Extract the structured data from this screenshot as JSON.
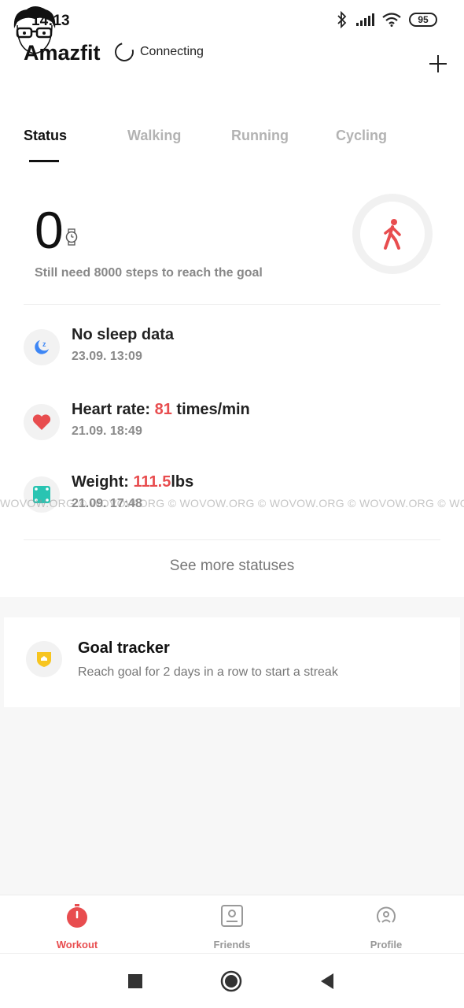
{
  "status_bar": {
    "time": "14:13",
    "battery": "95"
  },
  "header": {
    "app_title": "Amazfit",
    "connection_status": "Connecting"
  },
  "tabs": [
    {
      "label": "Status",
      "active": true
    },
    {
      "label": "Walking",
      "active": false
    },
    {
      "label": "Running",
      "active": false
    },
    {
      "label": "Cycling",
      "active": false
    }
  ],
  "steps": {
    "value": "0",
    "hint": "Still need 8000 steps to reach the goal"
  },
  "statuses": {
    "sleep": {
      "title": "No sleep data",
      "date": "23.09. 13:09"
    },
    "heart": {
      "label": "Heart rate: ",
      "value": "81",
      "unit": " times/min",
      "date": "21.09. 18:49"
    },
    "weight": {
      "label": "Weight: ",
      "value": "111.5",
      "unit": "lbs",
      "date": "21.09. 17:48"
    }
  },
  "see_more": "See more statuses",
  "watermark": "WOVOW.ORG © WOVOW.ORG © WOVOW.ORG © WOVOW.ORG © WOVOW.ORG © WOVOW.ORG ©",
  "goal_tracker": {
    "title": "Goal tracker",
    "subtitle": "Reach goal for 2 days in a row to start a streak"
  },
  "bottom_nav": [
    {
      "label": "Workout",
      "icon": "stopwatch-icon",
      "active": true
    },
    {
      "label": "Friends",
      "icon": "friends-icon",
      "active": false
    },
    {
      "label": "Profile",
      "icon": "profile-icon",
      "active": false
    }
  ],
  "colors": {
    "accent_red": "#e84d4f",
    "sleep_blue": "#3d86f5",
    "weight_teal": "#29c4b2",
    "goal_yellow": "#f7c520"
  }
}
